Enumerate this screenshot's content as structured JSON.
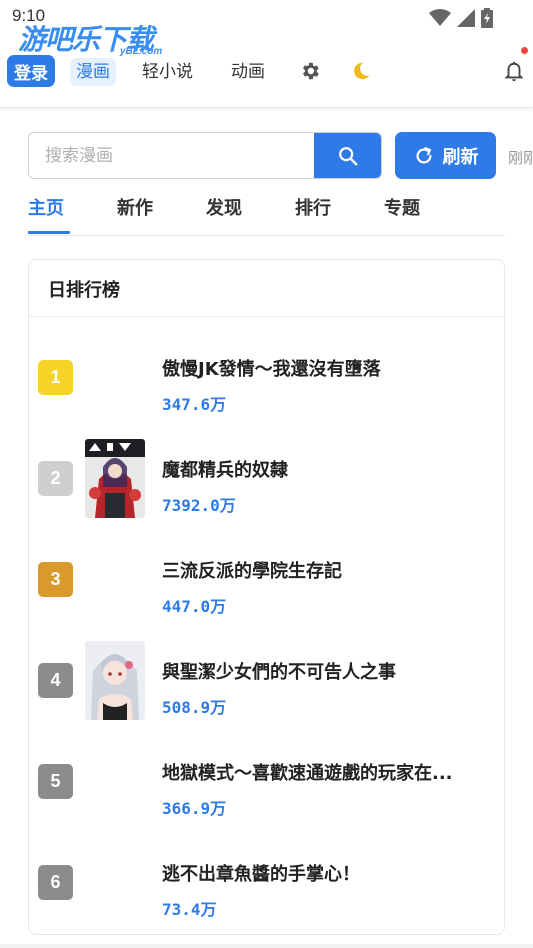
{
  "status_bar": {
    "time": "9:10"
  },
  "watermark": {
    "main": "游吧乐下载",
    "sub": "yBL.com"
  },
  "header": {
    "login_label": "登录",
    "nav": [
      {
        "label": "漫画",
        "active": true
      },
      {
        "label": "轻小说",
        "active": false
      },
      {
        "label": "动画",
        "active": false
      }
    ],
    "settings_icon": "gear-icon",
    "theme_icon": "moon-icon",
    "notification_icon": "bell-icon"
  },
  "search": {
    "placeholder": "搜索漫画",
    "value": "",
    "search_icon": "search-icon",
    "refresh_label": "刷新",
    "refresh_icon": "refresh-icon",
    "refresh_time": "刚刚"
  },
  "tabs": [
    {
      "label": "主页",
      "active": true
    },
    {
      "label": "新作",
      "active": false
    },
    {
      "label": "发现",
      "active": false
    },
    {
      "label": "排行",
      "active": false
    },
    {
      "label": "专题",
      "active": false
    }
  ],
  "ranking": {
    "title": "日排行榜",
    "items": [
      {
        "rank": "1",
        "title": "傲慢JK發情～我還沒有墮落",
        "views": "347.6万",
        "badge_color": "#f5d327",
        "has_cover": false
      },
      {
        "rank": "2",
        "title": "魔都精兵的奴隸",
        "views": "7392.0万",
        "badge_color": "#cfcfcf",
        "has_cover": true
      },
      {
        "rank": "3",
        "title": "三流反派的學院生存記",
        "views": "447.0万",
        "badge_color": "#d99a2b",
        "has_cover": false
      },
      {
        "rank": "4",
        "title": "與聖潔少女們的不可告人之事",
        "views": "508.9万",
        "badge_color": "#8c8c8c",
        "has_cover": true
      },
      {
        "rank": "5",
        "title": "地獄模式～喜歡速通遊戲的玩家在...",
        "views": "366.9万",
        "badge_color": "#8c8c8c",
        "has_cover": false
      },
      {
        "rank": "6",
        "title": "逃不出章魚醬的手掌心！",
        "views": "73.4万",
        "badge_color": "#8c8c8c",
        "has_cover": false
      }
    ]
  },
  "colors": {
    "accent": "#2e7be8",
    "active_tab_bg": "#e7f0fd",
    "notification_dot": "#f0443c"
  }
}
